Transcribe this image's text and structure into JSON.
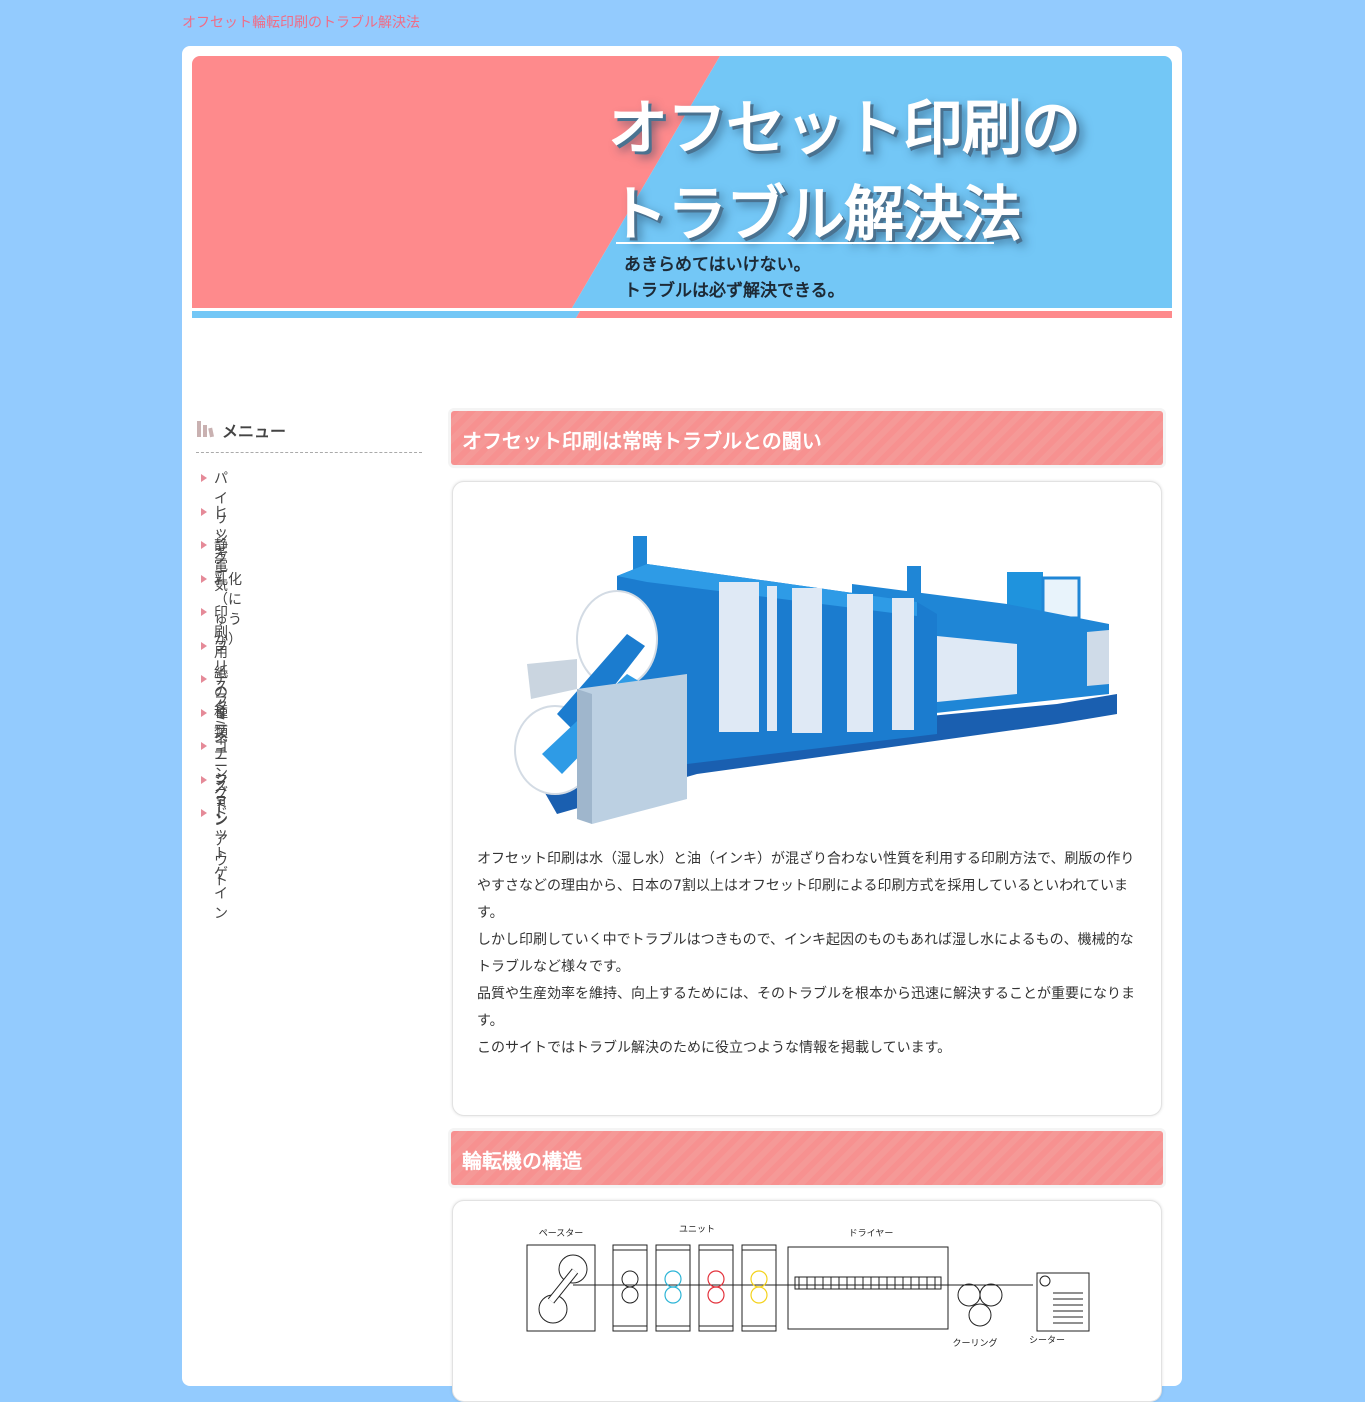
{
  "site": {
    "top_title": "オフセット輪転印刷のトラブル解決法"
  },
  "header": {
    "title_line1": "オフセット印刷の",
    "title_line2": "トラブル解決法",
    "tagline_line1": "あきらめてはいけない。",
    "tagline_line2": "トラブルは必ず解決できる。",
    "colors": {
      "pink": "#fe8a8c",
      "blue": "#73c7f6"
    }
  },
  "sidebar": {
    "title": "メニュー",
    "items": [
      {
        "label": "パイリング"
      },
      {
        "label": "ヒッキー"
      },
      {
        "label": "静電気"
      },
      {
        "label": "乳化（にゅうか）"
      },
      {
        "label": "印刷用紙の種類"
      },
      {
        "label": "ブリスター"
      },
      {
        "label": "デラミネーション"
      },
      {
        "label": "ミスチング"
      },
      {
        "label": "ゴースト"
      },
      {
        "label": "ファンアウト"
      },
      {
        "label": "ドットゲイン"
      }
    ]
  },
  "main": {
    "sections": [
      {
        "heading": "オフセット印刷は常時トラブルとの闘い"
      },
      {
        "heading": "輪転機の構造"
      }
    ],
    "intro_paragraphs": [
      "オフセット印刷は水（湿し水）と油（インキ）が混ざり合わない性質を利用する印刷方法で、刷版の作りやすさなどの理由から、日本の7割以上はオフセット印刷による印刷方式を採用しているといわれています。",
      "しかし印刷していく中でトラブルはつきもので、インキ起因のものもあれば湿し水によるもの、機械的なトラブルなど様々です。",
      "品質や生産効率を維持、向上するためには、そのトラブルを根本から迅速に解決することが重要になります。",
      "このサイトではトラブル解決のために役立つような情報を掲載しています。"
    ],
    "diagram": {
      "labels": {
        "paster": "ペースター",
        "unit": "ユニット",
        "dryer": "ドライヤー",
        "cooling": "クーリング",
        "sheeter": "シーター"
      }
    }
  }
}
